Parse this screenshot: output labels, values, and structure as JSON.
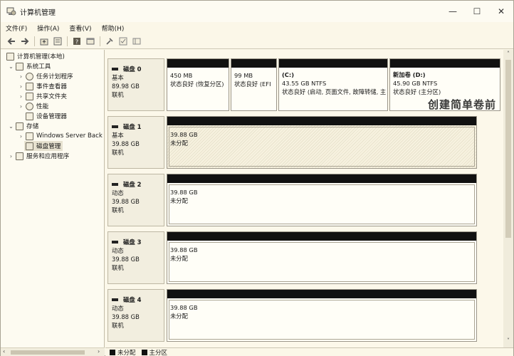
{
  "window": {
    "title": "计算机管理",
    "minimize": "—",
    "maximize": "☐",
    "close": "✕"
  },
  "menu": [
    "文件(F)",
    "操作(A)",
    "查看(V)",
    "帮助(H)"
  ],
  "toolbar_icons": [
    "back-arrow-icon",
    "forward-arrow-icon",
    "up-folder-icon",
    "properties-icon",
    "help-icon",
    "console-icon",
    "connect-icon",
    "check-icon",
    "panel-icon"
  ],
  "tree": {
    "root": "计算机管理(本地)",
    "system_tools": "系统工具",
    "task_scheduler": "任务计划程序",
    "event_viewer": "事件查看器",
    "shared_folders": "共享文件夹",
    "performance": "性能",
    "device_manager": "设备管理器",
    "storage": "存储",
    "windows_server_backup": "Windows Server Back",
    "disk_management": "磁盘管理",
    "services_apps": "服务和应用程序"
  },
  "disks": [
    {
      "name": "磁盘 0",
      "type": "基本",
      "size": "89.98 GB",
      "status": "联机",
      "volumes": [
        {
          "title": "",
          "line1": "450 MB",
          "line2": "状态良好 (恢复分区)"
        },
        {
          "title": "",
          "line1": "99 MB",
          "line2": "状态良好 (EFI"
        },
        {
          "title": "(C:)",
          "line1": "43.55 GB NTFS",
          "line2": "状态良好 (启动, 页面文件, 故障转储, 主"
        },
        {
          "title": "新加卷  (D:)",
          "line1": "45.90 GB NTFS",
          "line2": "状态良好 (主分区)"
        }
      ]
    },
    {
      "name": "磁盘 1",
      "type": "基本",
      "size": "39.88 GB",
      "status": "联机",
      "volumes": [
        {
          "title": "",
          "line1": "39.88 GB",
          "line2": "未分配"
        }
      ]
    },
    {
      "name": "磁盘 2",
      "type": "动态",
      "size": "39.88 GB",
      "status": "联机",
      "volumes": [
        {
          "title": "",
          "line1": "39.88 GB",
          "line2": "未分配"
        }
      ]
    },
    {
      "name": "磁盘 3",
      "type": "动态",
      "size": "39.88 GB",
      "status": "联机",
      "volumes": [
        {
          "title": "",
          "line1": "39.88 GB",
          "line2": "未分配"
        }
      ]
    },
    {
      "name": "磁盘 4",
      "type": "动态",
      "size": "39.88 GB",
      "status": "联机",
      "volumes": [
        {
          "title": "",
          "line1": "39.88 GB",
          "line2": "未分配"
        }
      ]
    }
  ],
  "overlay_caption": "创建简单卷前",
  "legend": {
    "unallocated": "未分配",
    "primary": "主分区"
  }
}
